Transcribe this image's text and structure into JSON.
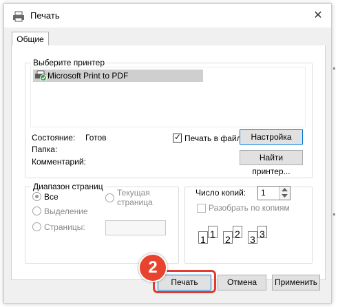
{
  "window": {
    "title": "Печать",
    "close_symbol": "✕"
  },
  "tabs": [
    {
      "label": "Общие"
    }
  ],
  "printer_group": {
    "legend": "Выберите принтер",
    "printers": [
      {
        "name": "Microsoft Print to PDF",
        "selected": true
      }
    ],
    "status_label": "Состояние:",
    "status_value": "Готов",
    "folder_label": "Папка:",
    "comment_label": "Комментарий:",
    "print_to_file_label": "Печать в файл",
    "print_to_file_checked": true,
    "settings_button": "Настройка",
    "find_printer_button": "Найти принтер..."
  },
  "page_range": {
    "legend": "Диапазон страниц",
    "options": [
      {
        "label": "Все",
        "selected": true
      },
      {
        "label": "Выделение",
        "selected": false
      },
      {
        "label": "Страницы:",
        "selected": false
      },
      {
        "label_line1": "Текущая",
        "label_line2": "страница",
        "selected": false
      }
    ],
    "pages_value": ""
  },
  "copies": {
    "label": "Число копий:",
    "value": "1",
    "collate_label": "Разобрать по копиям",
    "collate_checked": false,
    "collate_icon_labels": [
      "1",
      "1",
      "2",
      "2",
      "3",
      "3"
    ]
  },
  "footer": {
    "print_button": "Печать",
    "cancel_button": "Отмена",
    "apply_button": "Применить"
  },
  "annotation": {
    "step_number": "2",
    "accent_color": "#e8432f"
  }
}
